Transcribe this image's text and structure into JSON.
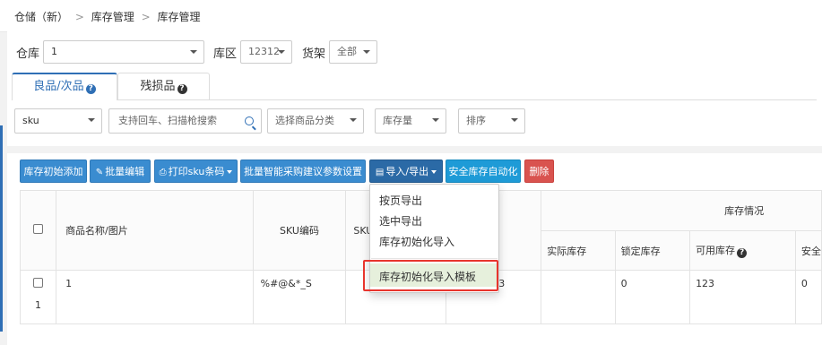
{
  "breadcrumb": {
    "root": "仓储（新）",
    "sep": ">",
    "level1": "库存管理",
    "level2": "库存管理"
  },
  "filters_top": {
    "warehouse_label": "仓库",
    "warehouse_value": "1",
    "zone_label": "库区",
    "zone_value": "12312",
    "shelf_label": "货架",
    "shelf_value": "全部"
  },
  "tabs": [
    {
      "label": "良品/次品",
      "active": true
    },
    {
      "label": "残损品",
      "active": false
    }
  ],
  "filters": {
    "sku_select": "sku",
    "search_placeholder": "支持回车、扫描枪搜索",
    "category_select": "选择商品分类",
    "stock_qty_select": "库存量",
    "sort_select": "排序"
  },
  "toolbar": {
    "init_add": "库存初始添加",
    "batch_edit": "批量编辑",
    "print_sku": "打印sku条码",
    "smart_purchase": "批量智能采购建议参数设置",
    "import_export": "导入/导出",
    "safe_stock": "安全库存自动化",
    "delete": "删除"
  },
  "dropdown": {
    "items": [
      "按页导出",
      "选中导出",
      "库存初始化导入",
      "库存初始化导入模板"
    ],
    "highlighted_index": 3
  },
  "table": {
    "headers": {
      "product": "商品名称/图片",
      "sku_code": "SKU编码",
      "sku_col": "SKU",
      "stock_group": "库存情况",
      "actual": "实际库存",
      "locked": "锁定库存",
      "available": "可用库存",
      "safety": "安全"
    },
    "rows": [
      {
        "index": "1",
        "product": "1",
        "sku_code": "%#@&*_S",
        "actual": "123",
        "locked": "0",
        "available": "123",
        "safety": "0"
      }
    ]
  },
  "colors": {
    "primary": "#2f6fb5",
    "danger": "#d9534f",
    "highlight_border": "#e8342d",
    "highlight_bg": "#e6f0dc"
  }
}
